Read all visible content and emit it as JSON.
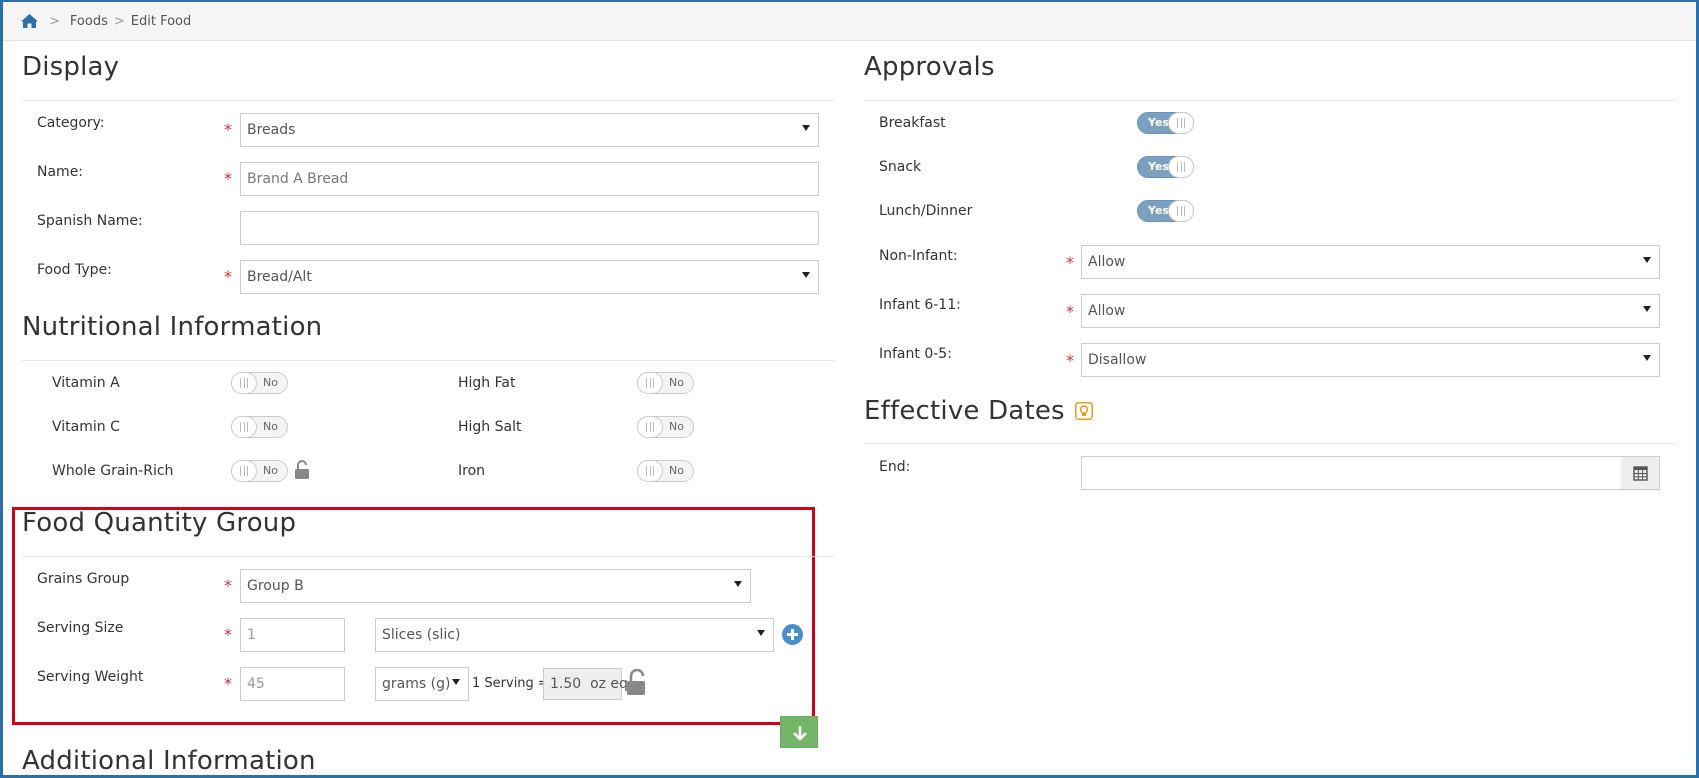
{
  "breadcrumb": {
    "items": [
      "Foods",
      "Edit Food"
    ]
  },
  "display": {
    "title": "Display",
    "category_label": "Category:",
    "category_value": "Breads",
    "name_label": "Name:",
    "name_value": "Brand A Bread",
    "spanish_label": "Spanish Name:",
    "spanish_value": "",
    "foodtype_label": "Food Type:",
    "foodtype_value": "Bread/Alt"
  },
  "nutrition": {
    "title": "Nutritional Information",
    "left": [
      {
        "label": "Vitamin A",
        "state": "No"
      },
      {
        "label": "Vitamin C",
        "state": "No"
      },
      {
        "label": "Whole Grain-Rich",
        "state": "No"
      }
    ],
    "right": [
      {
        "label": "High Fat",
        "state": "No"
      },
      {
        "label": "High Salt",
        "state": "No"
      },
      {
        "label": "Iron",
        "state": "No"
      }
    ]
  },
  "fqg": {
    "title": "Food Quantity Group",
    "grains_label": "Grains Group",
    "grains_value": "Group B",
    "serving_size_label": "Serving Size",
    "serving_size_value": "1",
    "serving_unit_value": "Slices (slic)",
    "serving_weight_label": "Serving Weight",
    "serving_weight_value": "45",
    "weight_unit_value": "grams (g)",
    "serving_equals": "1 Serving =",
    "oz_eq_value": "1.50  oz eq"
  },
  "additional": {
    "title": "Additional Information"
  },
  "approvals": {
    "title": "Approvals",
    "toggles": [
      {
        "label": "Breakfast",
        "state": "Yes"
      },
      {
        "label": "Snack",
        "state": "Yes"
      },
      {
        "label": "Lunch/Dinner",
        "state": "Yes"
      }
    ],
    "noninfant_label": "Non-Infant:",
    "noninfant_value": "Allow",
    "infant611_label": "Infant 6-11:",
    "infant611_value": "Allow",
    "infant05_label": "Infant 0-5:",
    "infant05_value": "Disallow"
  },
  "effective": {
    "title": "Effective Dates",
    "end_label": "End:",
    "end_value": ""
  },
  "colors": {
    "accent": "#2b6ea8",
    "required": "#cc3333",
    "highlight": "#d0021b",
    "toggle_on": "#7ba0c0"
  }
}
